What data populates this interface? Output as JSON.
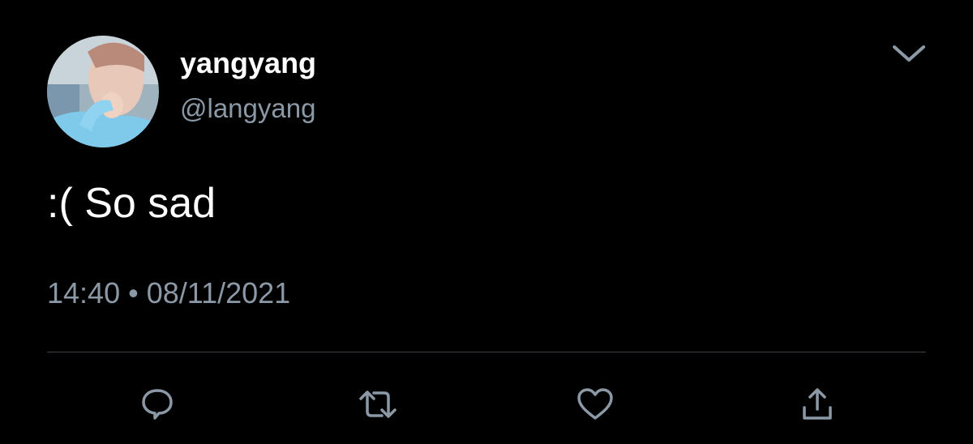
{
  "user": {
    "display_name": "yangyang",
    "handle": "@langyang",
    "avatar": "profile-photo"
  },
  "tweet": {
    "text": ":( So sad",
    "time": "14:40",
    "separator": "•",
    "date": "08/11/2021"
  },
  "icons": {
    "more": "chevron-down-icon",
    "reply": "reply-icon",
    "retweet": "retweet-icon",
    "like": "heart-icon",
    "share": "share-icon"
  },
  "colors": {
    "background": "#000000",
    "primary_text": "#ffffff",
    "secondary_text": "#8b98a5",
    "divider": "#3a4148"
  }
}
